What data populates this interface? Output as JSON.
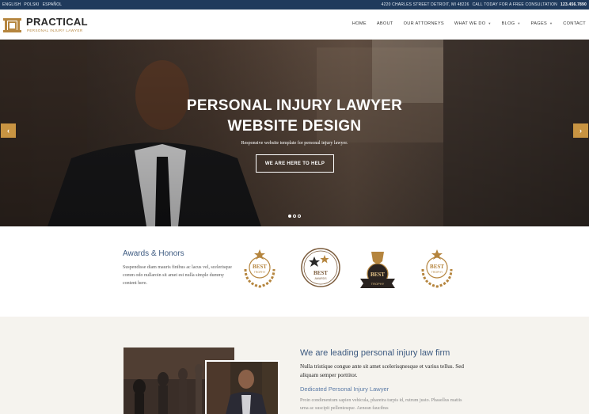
{
  "topbar": {
    "languages": [
      "ENGLISH",
      "POLSKI",
      "ESPAÑOL"
    ],
    "address": "4220 CHARLES STREET DETROIT, MI 48226",
    "call_text": "CALL TODAY FOR A FREE CONSULTATION",
    "phone": "123.456.7890"
  },
  "header": {
    "brand": "PRACTICAL",
    "tagline": "PERSONAL INJURY LAWYER",
    "nav": [
      {
        "label": "HOME",
        "dropdown": false
      },
      {
        "label": "ABOUT",
        "dropdown": false
      },
      {
        "label": "OUR ATTORNEYS",
        "dropdown": false
      },
      {
        "label": "WHAT WE DO",
        "dropdown": true
      },
      {
        "label": "BLOG",
        "dropdown": true
      },
      {
        "label": "PAGES",
        "dropdown": true
      },
      {
        "label": "CONTACT",
        "dropdown": false
      }
    ]
  },
  "hero": {
    "title_line1": "PERSONAL INJURY LAWYER",
    "title_line2": "WEBSITE DESIGN",
    "subtitle": "Responsive website template for personal injury lawyer.",
    "button": "WE ARE HERE TO HELP",
    "prev_icon": "chevron-left-icon",
    "next_icon": "chevron-right-icon",
    "slide_count": 3,
    "active_slide": 1
  },
  "awards": {
    "title": "Awards & Honors",
    "text": "Suspendisse diam mauris finibus ac lacus vel, scelerisque comm odo nullaroin sit amet est nulla simple dummy content here.",
    "badges": [
      {
        "icon": "laurel-star-badge-icon",
        "line1": "BEST",
        "line2": "TROPHY"
      },
      {
        "icon": "star-seal-badge-icon",
        "line1": "BEST",
        "line2": "AWARDS"
      },
      {
        "icon": "trophy-ribbon-badge-icon",
        "line1": "BEST",
        "line2": "TROPHY"
      },
      {
        "icon": "laurel-star-badge-icon",
        "line1": "BEST",
        "line2": "TROPHY"
      }
    ]
  },
  "firm": {
    "title": "We are leading personal injury law firm",
    "lead": "Nulla tristique congue ante sit amet scelerisqnesque et varius tellus. Sed aliquam semper porttitor.",
    "subtitle": "Dedicated Personal Injury Lawyer",
    "text": "Proin condimentum sapien vehicula, pharetra turpis id, rutrum justo. Phasellus mattis urna ac suscipit pellentesque. Aenean faucibus"
  },
  "colors": {
    "topbar_bg": "#1f3a5c",
    "accent_gold": "#c89442",
    "heading_blue": "#3d5a80",
    "section_bg": "#f5f3ee"
  }
}
